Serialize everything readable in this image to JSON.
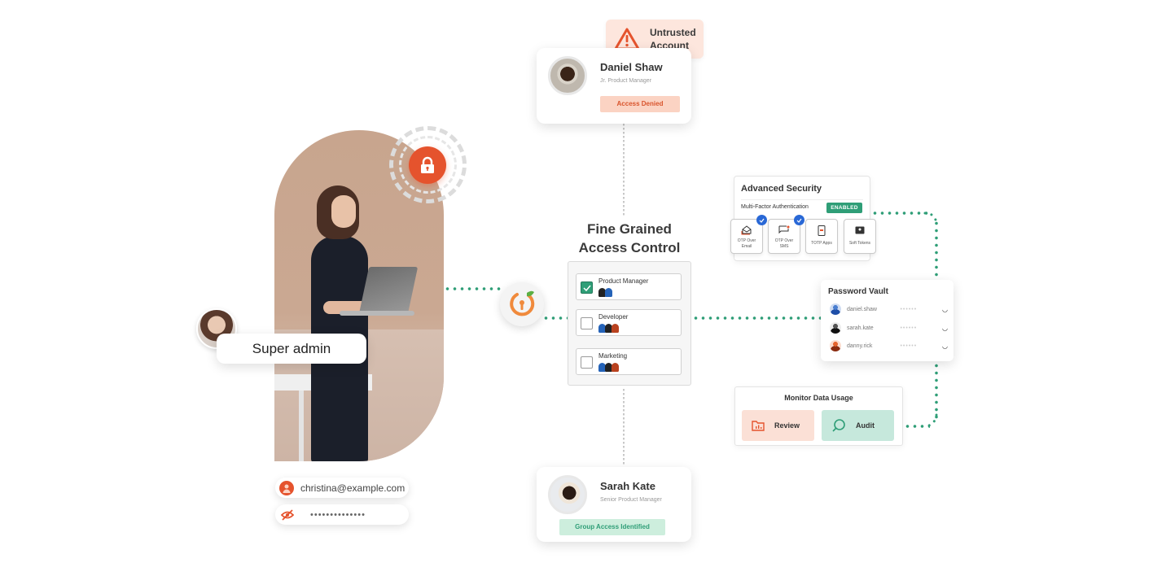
{
  "warning": {
    "icon": "warning-triangle-icon",
    "line1": "Untrusted",
    "line2": "Account"
  },
  "daniel": {
    "name": "Daniel Shaw",
    "role": "Jr. Product Manager",
    "status": "Access Denied"
  },
  "sarah": {
    "name": "Sarah Kate",
    "role": "Senior Product Manager",
    "status": "Group Access Identified"
  },
  "admin": {
    "label": "Super admin",
    "email": "christina@example.com",
    "password": "••••••••••••••"
  },
  "fgac": {
    "title_line1": "Fine Grained",
    "title_line2": "Access Control",
    "roles": [
      {
        "label": "Product Manager",
        "checked": true
      },
      {
        "label": "Developer",
        "checked": false
      },
      {
        "label": "Marketing",
        "checked": false
      }
    ]
  },
  "advanced_security": {
    "title": "Advanced Security",
    "mfa_label": "Multi-Factor Authentication",
    "mfa_status": "ENABLED",
    "options": [
      {
        "line1": "OTP Over",
        "line2": "Email",
        "selected": true
      },
      {
        "line1": "OTP Over",
        "line2": "SMS",
        "selected": true
      },
      {
        "line1": "TOTP Apps",
        "line2": "",
        "selected": false
      },
      {
        "line1": "Soft Tokens",
        "line2": "",
        "selected": false
      }
    ]
  },
  "password_vault": {
    "title": "Password Vault",
    "entries": [
      {
        "user": "daniel.shaw",
        "mask": "••••••"
      },
      {
        "user": "sarah.kate",
        "mask": "••••••"
      },
      {
        "user": "danny.rick",
        "mask": "••••••"
      }
    ]
  },
  "monitor": {
    "title": "Monitor Data Usage",
    "review": "Review",
    "audit": "Audit"
  },
  "colors": {
    "accent_orange": "#e5532d",
    "accent_green": "#2f9e77",
    "denied_bg": "#fbd3c3",
    "granted_bg": "#cdeedd",
    "check_blue": "#2968d6"
  }
}
